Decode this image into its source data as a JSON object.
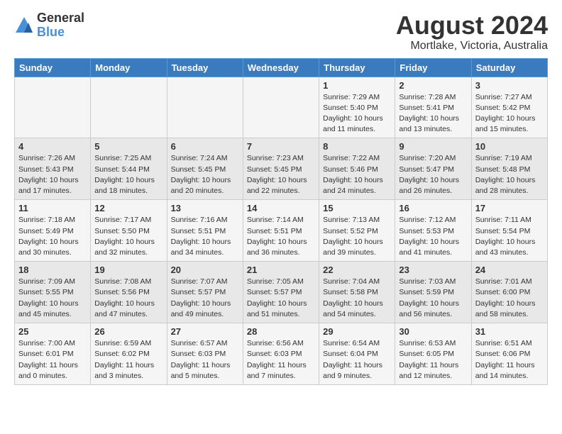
{
  "header": {
    "logo_general": "General",
    "logo_blue": "Blue",
    "month_title": "August 2024",
    "location": "Mortlake, Victoria, Australia"
  },
  "days_of_week": [
    "Sunday",
    "Monday",
    "Tuesday",
    "Wednesday",
    "Thursday",
    "Friday",
    "Saturday"
  ],
  "weeks": [
    [
      {
        "day": "",
        "info": ""
      },
      {
        "day": "",
        "info": ""
      },
      {
        "day": "",
        "info": ""
      },
      {
        "day": "",
        "info": ""
      },
      {
        "day": "1",
        "info": "Sunrise: 7:29 AM\nSunset: 5:40 PM\nDaylight: 10 hours\nand 11 minutes."
      },
      {
        "day": "2",
        "info": "Sunrise: 7:28 AM\nSunset: 5:41 PM\nDaylight: 10 hours\nand 13 minutes."
      },
      {
        "day": "3",
        "info": "Sunrise: 7:27 AM\nSunset: 5:42 PM\nDaylight: 10 hours\nand 15 minutes."
      }
    ],
    [
      {
        "day": "4",
        "info": "Sunrise: 7:26 AM\nSunset: 5:43 PM\nDaylight: 10 hours\nand 17 minutes."
      },
      {
        "day": "5",
        "info": "Sunrise: 7:25 AM\nSunset: 5:44 PM\nDaylight: 10 hours\nand 18 minutes."
      },
      {
        "day": "6",
        "info": "Sunrise: 7:24 AM\nSunset: 5:45 PM\nDaylight: 10 hours\nand 20 minutes."
      },
      {
        "day": "7",
        "info": "Sunrise: 7:23 AM\nSunset: 5:45 PM\nDaylight: 10 hours\nand 22 minutes."
      },
      {
        "day": "8",
        "info": "Sunrise: 7:22 AM\nSunset: 5:46 PM\nDaylight: 10 hours\nand 24 minutes."
      },
      {
        "day": "9",
        "info": "Sunrise: 7:20 AM\nSunset: 5:47 PM\nDaylight: 10 hours\nand 26 minutes."
      },
      {
        "day": "10",
        "info": "Sunrise: 7:19 AM\nSunset: 5:48 PM\nDaylight: 10 hours\nand 28 minutes."
      }
    ],
    [
      {
        "day": "11",
        "info": "Sunrise: 7:18 AM\nSunset: 5:49 PM\nDaylight: 10 hours\nand 30 minutes."
      },
      {
        "day": "12",
        "info": "Sunrise: 7:17 AM\nSunset: 5:50 PM\nDaylight: 10 hours\nand 32 minutes."
      },
      {
        "day": "13",
        "info": "Sunrise: 7:16 AM\nSunset: 5:51 PM\nDaylight: 10 hours\nand 34 minutes."
      },
      {
        "day": "14",
        "info": "Sunrise: 7:14 AM\nSunset: 5:51 PM\nDaylight: 10 hours\nand 36 minutes."
      },
      {
        "day": "15",
        "info": "Sunrise: 7:13 AM\nSunset: 5:52 PM\nDaylight: 10 hours\nand 39 minutes."
      },
      {
        "day": "16",
        "info": "Sunrise: 7:12 AM\nSunset: 5:53 PM\nDaylight: 10 hours\nand 41 minutes."
      },
      {
        "day": "17",
        "info": "Sunrise: 7:11 AM\nSunset: 5:54 PM\nDaylight: 10 hours\nand 43 minutes."
      }
    ],
    [
      {
        "day": "18",
        "info": "Sunrise: 7:09 AM\nSunset: 5:55 PM\nDaylight: 10 hours\nand 45 minutes."
      },
      {
        "day": "19",
        "info": "Sunrise: 7:08 AM\nSunset: 5:56 PM\nDaylight: 10 hours\nand 47 minutes."
      },
      {
        "day": "20",
        "info": "Sunrise: 7:07 AM\nSunset: 5:57 PM\nDaylight: 10 hours\nand 49 minutes."
      },
      {
        "day": "21",
        "info": "Sunrise: 7:05 AM\nSunset: 5:57 PM\nDaylight: 10 hours\nand 51 minutes."
      },
      {
        "day": "22",
        "info": "Sunrise: 7:04 AM\nSunset: 5:58 PM\nDaylight: 10 hours\nand 54 minutes."
      },
      {
        "day": "23",
        "info": "Sunrise: 7:03 AM\nSunset: 5:59 PM\nDaylight: 10 hours\nand 56 minutes."
      },
      {
        "day": "24",
        "info": "Sunrise: 7:01 AM\nSunset: 6:00 PM\nDaylight: 10 hours\nand 58 minutes."
      }
    ],
    [
      {
        "day": "25",
        "info": "Sunrise: 7:00 AM\nSunset: 6:01 PM\nDaylight: 11 hours\nand 0 minutes."
      },
      {
        "day": "26",
        "info": "Sunrise: 6:59 AM\nSunset: 6:02 PM\nDaylight: 11 hours\nand 3 minutes."
      },
      {
        "day": "27",
        "info": "Sunrise: 6:57 AM\nSunset: 6:03 PM\nDaylight: 11 hours\nand 5 minutes."
      },
      {
        "day": "28",
        "info": "Sunrise: 6:56 AM\nSunset: 6:03 PM\nDaylight: 11 hours\nand 7 minutes."
      },
      {
        "day": "29",
        "info": "Sunrise: 6:54 AM\nSunset: 6:04 PM\nDaylight: 11 hours\nand 9 minutes."
      },
      {
        "day": "30",
        "info": "Sunrise: 6:53 AM\nSunset: 6:05 PM\nDaylight: 11 hours\nand 12 minutes."
      },
      {
        "day": "31",
        "info": "Sunrise: 6:51 AM\nSunset: 6:06 PM\nDaylight: 11 hours\nand 14 minutes."
      }
    ]
  ]
}
